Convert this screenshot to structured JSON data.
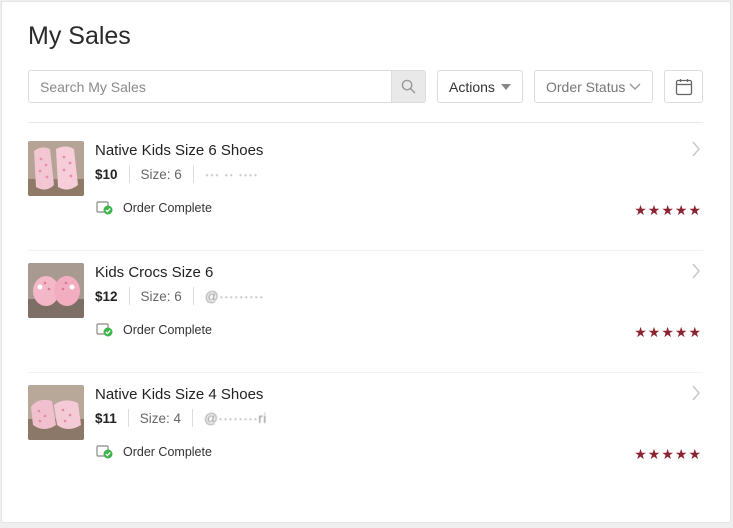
{
  "page": {
    "title": "My Sales"
  },
  "toolbar": {
    "search_placeholder": "Search My Sales",
    "search_icon": "search-icon",
    "actions_label": "Actions",
    "order_status_label": "Order Status",
    "calendar_icon": "calendar-icon"
  },
  "colors": {
    "star": "#8b2332",
    "status_check": "#3cb54a"
  },
  "sales": [
    {
      "title": "Native Kids Size 6 Shoes",
      "price": "$10",
      "size": "Size: 6",
      "buyer": "··· ·· ····",
      "status": "Order Complete",
      "rating": 5,
      "thumb": "pink-slip-on-shoes"
    },
    {
      "title": "Kids Crocs Size 6",
      "price": "$12",
      "size": "Size: 6",
      "buyer": "@·········",
      "status": "Order Complete",
      "rating": 5,
      "thumb": "pink-clogs"
    },
    {
      "title": "Native Kids Size 4 Shoes",
      "price": "$11",
      "size": "Size: 4",
      "buyer": "@········ri",
      "status": "Order Complete",
      "rating": 5,
      "thumb": "pink-slip-on-shoes"
    }
  ]
}
